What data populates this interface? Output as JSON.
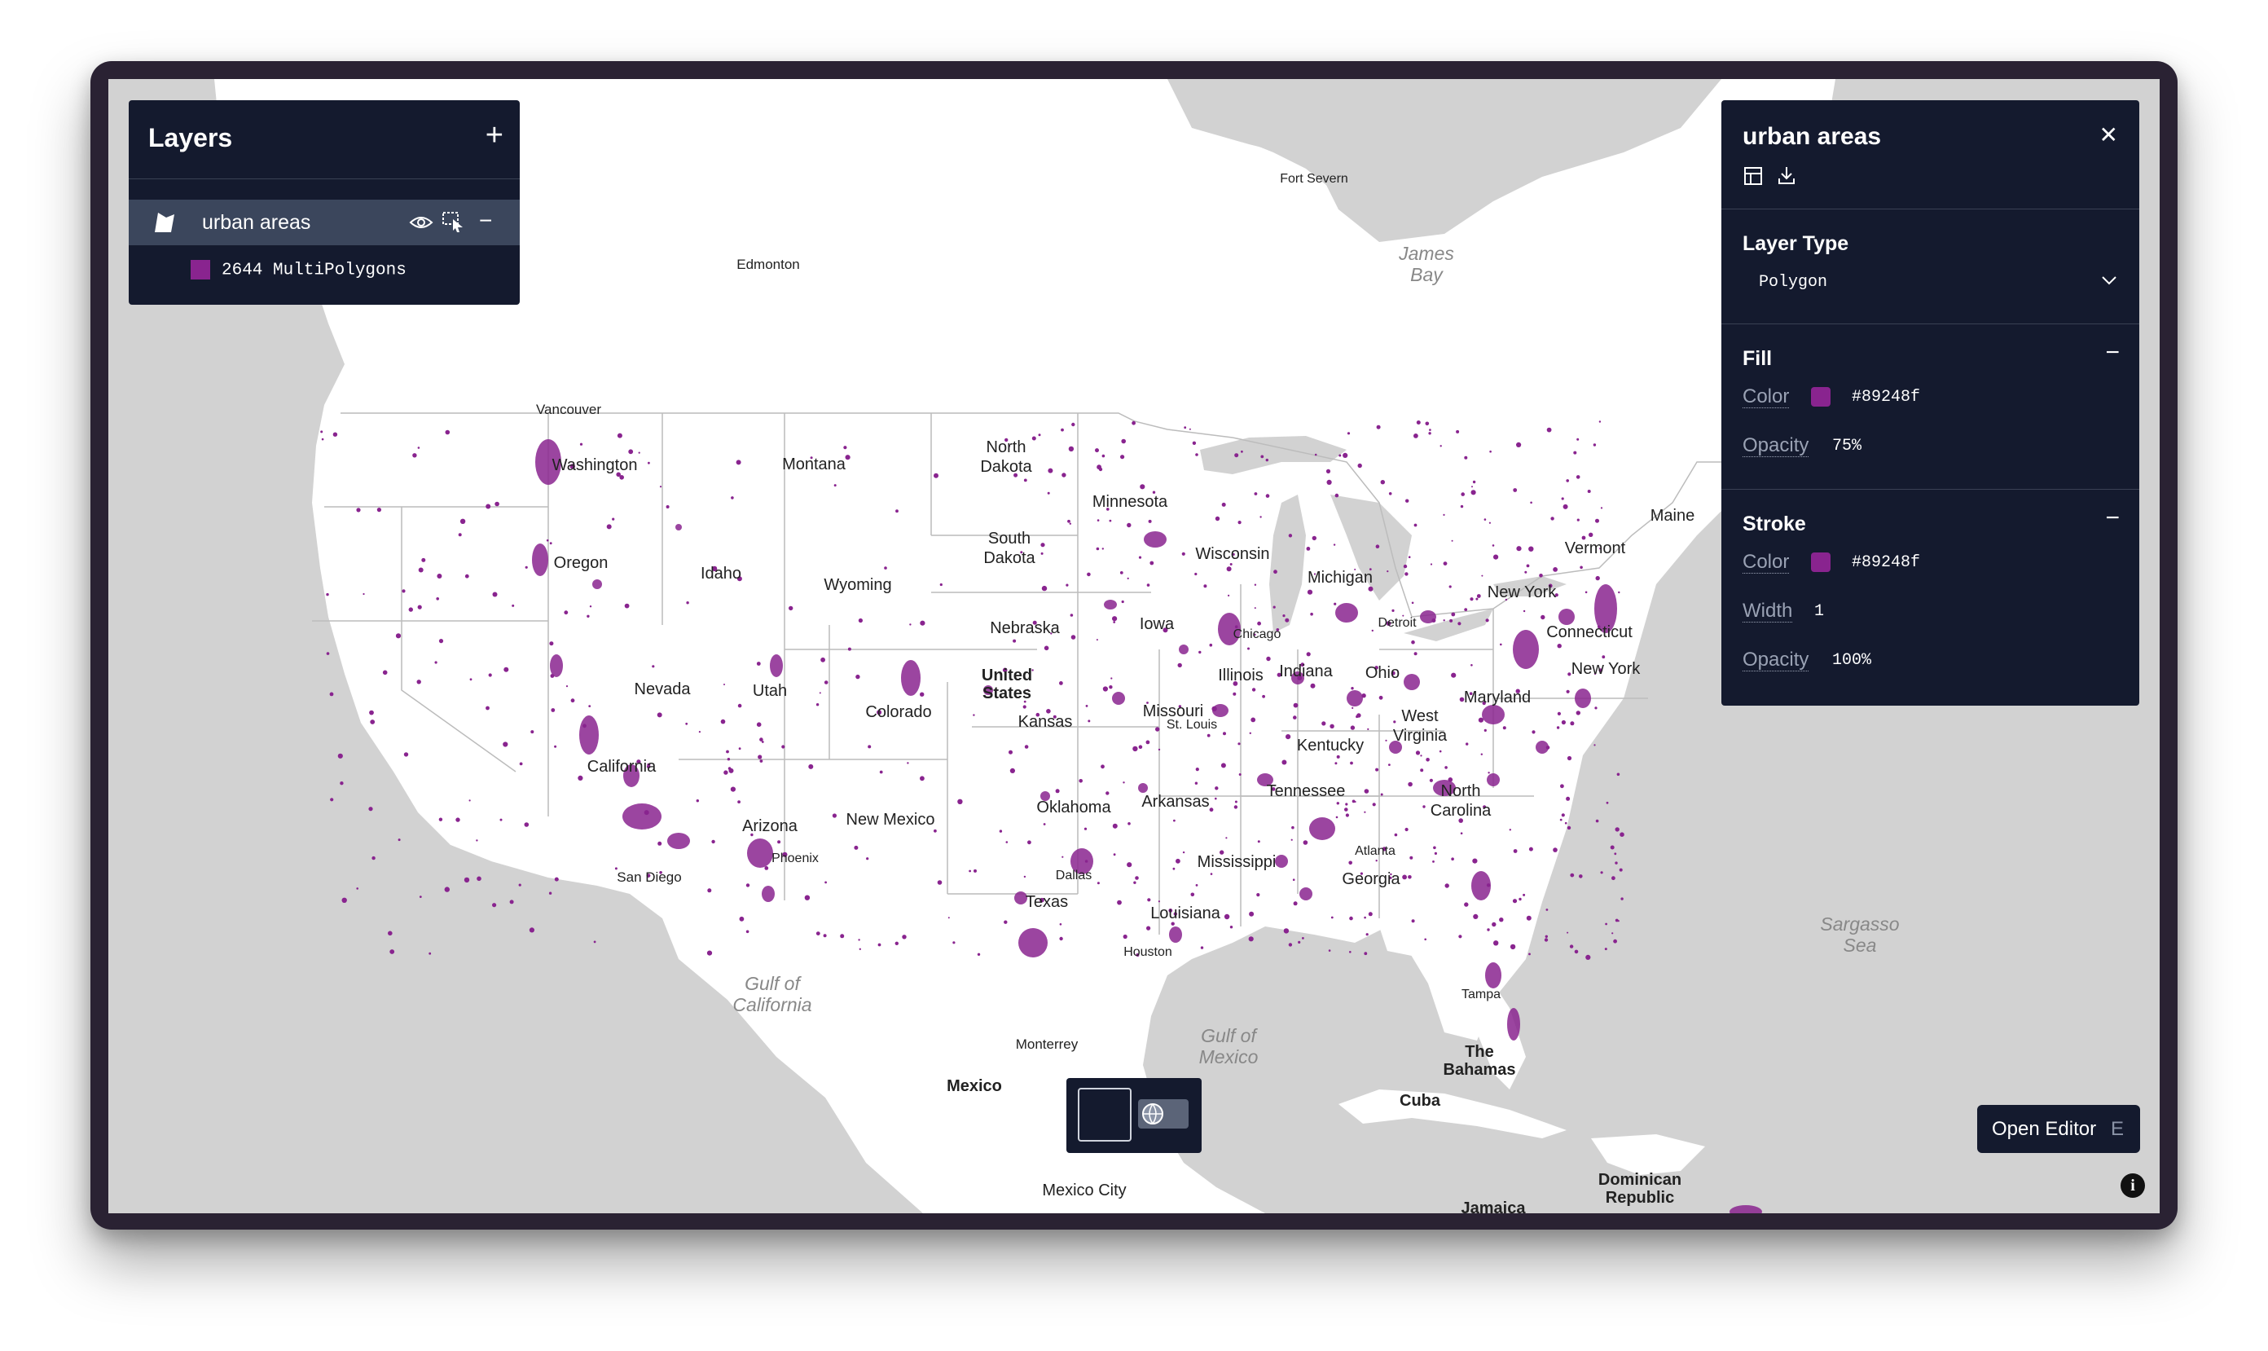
{
  "layers_panel": {
    "title": "Layers",
    "add_icon": "plus-icon",
    "layer": {
      "name": "urban areas",
      "icon": "polygon-layer-icon",
      "visibility_icon": "eye-icon",
      "select_icon": "cursor-select-icon",
      "remove_icon": "minus-icon",
      "legend_count": "2644 MultiPolygons",
      "legend_color": "#89248f"
    }
  },
  "properties_panel": {
    "title": "urban areas",
    "close_icon": "close-icon",
    "table_icon": "table-icon",
    "download_icon": "download-icon",
    "layer_type": {
      "label": "Layer Type",
      "value": "Polygon"
    },
    "fill": {
      "label": "Fill",
      "color_label": "Color",
      "color_value": "#89248f",
      "opacity_label": "Opacity",
      "opacity_value": "75%"
    },
    "stroke": {
      "label": "Stroke",
      "color_label": "Color",
      "color_value": "#89248f",
      "width_label": "Width",
      "width_value": "1",
      "opacity_label": "Opacity",
      "opacity_value": "100%"
    }
  },
  "open_editor": {
    "label": "Open Editor",
    "shortcut": "E"
  },
  "basemap_switcher": {
    "dark_option": "dark-basemap",
    "globe_icon": "globe-icon"
  },
  "info_icon": "info-icon",
  "map": {
    "water_labels": [
      "James Bay",
      "Gulf of California",
      "Gulf of Mexico",
      "Sargasso Sea"
    ],
    "country_labels": [
      "United States",
      "Mexico",
      "Cuba",
      "The Bahamas",
      "Dominican Republic",
      "Jamaica"
    ],
    "state_labels": [
      "Washington",
      "Oregon",
      "California",
      "Nevada",
      "Idaho",
      "Montana",
      "Wyoming",
      "Utah",
      "Arizona",
      "Colorado",
      "New Mexico",
      "North Dakota",
      "South Dakota",
      "Nebraska",
      "Kansas",
      "Oklahoma",
      "Texas",
      "Minnesota",
      "Iowa",
      "Missouri",
      "Arkansas",
      "Louisiana",
      "Wisconsin",
      "Illinois",
      "Mississippi",
      "Michigan",
      "Indiana",
      "Kentucky",
      "Tennessee",
      "Ohio",
      "Georgia",
      "West Virginia",
      "North Carolina",
      "Maryland",
      "New York",
      "Vermont",
      "Maine",
      "Connecticut"
    ],
    "city_labels": [
      "Fort Severn",
      "Edmonton",
      "Vancouver",
      "Chicago",
      "Detroit",
      "St. Louis",
      "Atlanta",
      "Dallas",
      "Houston",
      "Tampa",
      "Phoenix",
      "San Diego",
      "New York",
      "Monterrey",
      "Mexico City"
    ],
    "fill_color": "#89248f"
  }
}
